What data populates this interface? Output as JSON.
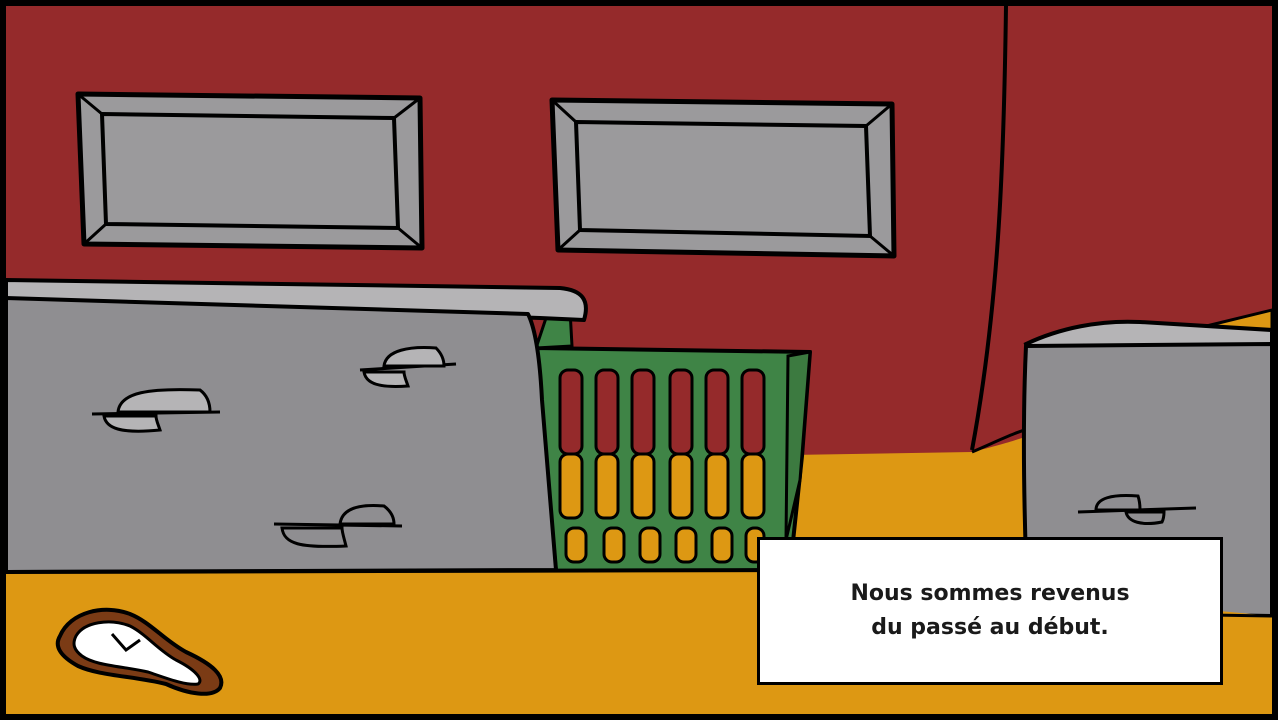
{
  "scene": {
    "name": "bedroom-scene",
    "colors": {
      "wall": "#952a2b",
      "floor": "#dd9813",
      "furniture_gray": "#8f8e91",
      "frame_gray": "#9b9a9c",
      "basket_green": "#3f8446",
      "clock_brown": "#7b3b15",
      "outline": "#000000"
    },
    "icons": [
      "melting-clock-icon",
      "handle-icon"
    ]
  },
  "dialog": {
    "line1": "Nous sommes revenus",
    "line2": "du passé au début."
  }
}
